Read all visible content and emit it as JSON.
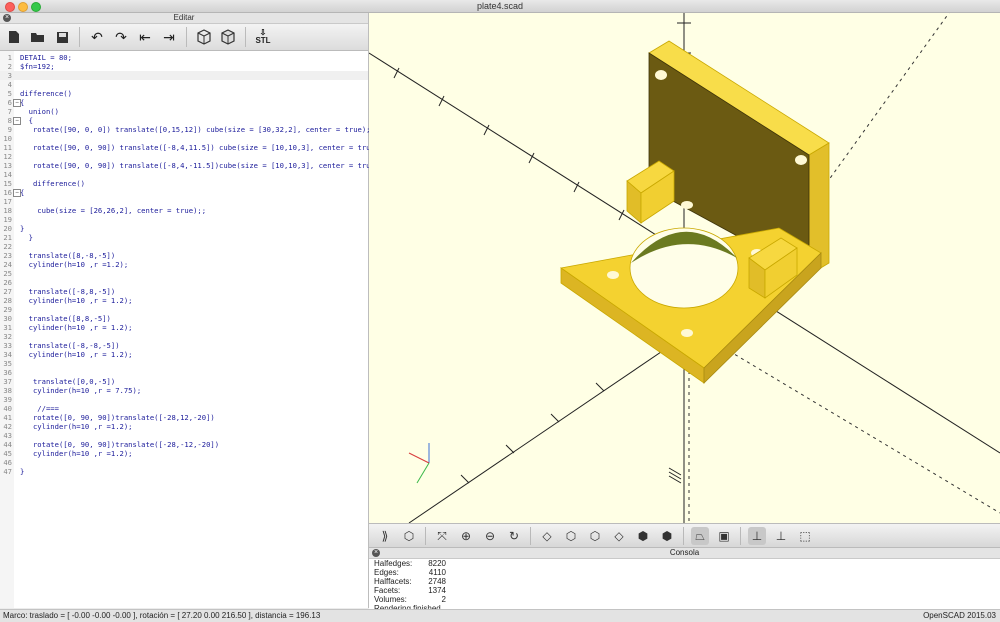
{
  "window": {
    "title": "plate4.scad"
  },
  "editor": {
    "title": "Editar",
    "toolbar": [
      "new-icon",
      "open-icon",
      "save-icon",
      "undo-icon",
      "redo-icon",
      "unindent-icon",
      "indent-icon",
      "preview-icon",
      "render-icon",
      "export-stl-icon"
    ],
    "stl_label": "STL",
    "lines": [
      {
        "n": "1",
        "t": "DETAIL = 80;"
      },
      {
        "n": "2",
        "t": "$fn=192;"
      },
      {
        "n": "3",
        "t": ""
      },
      {
        "n": "4",
        "t": ""
      },
      {
        "n": "5",
        "t": "difference()"
      },
      {
        "n": "6",
        "t": "{"
      },
      {
        "n": "7",
        "t": "  union()"
      },
      {
        "n": "8",
        "t": "  {"
      },
      {
        "n": "9",
        "t": "   rotate([90, 0, 0]) translate([0,15,12]) cube(size = [30,32,2], center = true);;"
      },
      {
        "n": "10",
        "t": ""
      },
      {
        "n": "11",
        "t": "   rotate([90, 0, 90]) translate([-8,4,11.5]) cube(size = [10,10,3], center = true);;"
      },
      {
        "n": "12",
        "t": ""
      },
      {
        "n": "13",
        "t": "   rotate([90, 0, 90]) translate([-8,4,-11.5])cube(size = [10,10,3], center = true);;"
      },
      {
        "n": "14",
        "t": ""
      },
      {
        "n": "15",
        "t": "   difference()"
      },
      {
        "n": "16",
        "t": "{"
      },
      {
        "n": "17",
        "t": ""
      },
      {
        "n": "18",
        "t": "    cube(size = [26,26,2], center = true);;"
      },
      {
        "n": "19",
        "t": ""
      },
      {
        "n": "20",
        "t": "}"
      },
      {
        "n": "21",
        "t": "  }"
      },
      {
        "n": "22",
        "t": ""
      },
      {
        "n": "23",
        "t": "  translate([8,-8,-5])"
      },
      {
        "n": "24",
        "t": "  cylinder(h=10 ,r =1.2);"
      },
      {
        "n": "25",
        "t": ""
      },
      {
        "n": "26",
        "t": ""
      },
      {
        "n": "27",
        "t": "  translate([-8,8,-5])"
      },
      {
        "n": "28",
        "t": "  cylinder(h=10 ,r = 1.2);"
      },
      {
        "n": "29",
        "t": ""
      },
      {
        "n": "30",
        "t": "  translate([8,8,-5])"
      },
      {
        "n": "31",
        "t": "  cylinder(h=10 ,r = 1.2);"
      },
      {
        "n": "32",
        "t": ""
      },
      {
        "n": "33",
        "t": "  translate([-8,-8,-5])"
      },
      {
        "n": "34",
        "t": "  cylinder(h=10 ,r = 1.2);"
      },
      {
        "n": "35",
        "t": ""
      },
      {
        "n": "36",
        "t": ""
      },
      {
        "n": "37",
        "t": "   translate([0,0,-5])"
      },
      {
        "n": "38",
        "t": "   cylinder(h=10 ,r = 7.75);"
      },
      {
        "n": "39",
        "t": ""
      },
      {
        "n": "40",
        "t": "    //==="
      },
      {
        "n": "41",
        "t": "   rotate([0, 90, 90])translate([-28,12,-20])"
      },
      {
        "n": "42",
        "t": "   cylinder(h=10 ,r =1.2);"
      },
      {
        "n": "43",
        "t": ""
      },
      {
        "n": "44",
        "t": "   rotate([0, 90, 90])translate([-28,-12,-20])"
      },
      {
        "n": "45",
        "t": "   cylinder(h=10 ,r =1.2);"
      },
      {
        "n": "46",
        "t": ""
      },
      {
        "n": "47",
        "t": "}"
      }
    ]
  },
  "console": {
    "title": "Consola",
    "rows": [
      {
        "label": "Halfedges:",
        "value": "8220"
      },
      {
        "label": "Edges:",
        "value": "4110"
      },
      {
        "label": "Halffacets:",
        "value": "2748"
      },
      {
        "label": "Facets:",
        "value": "1374"
      },
      {
        "label": "Volumes:",
        "value": "2"
      }
    ],
    "final": "Rendering finished."
  },
  "status": {
    "left": "Marco: traslado = [ -0.00 -0.00 -0.00 ], rotación = [ 27.20 0.00 216.50 ], distancia = 196.13",
    "right": "OpenSCAD 2015.03"
  },
  "colors": {
    "model": "#f5d233",
    "viewport_bg": "#ffffe5"
  }
}
